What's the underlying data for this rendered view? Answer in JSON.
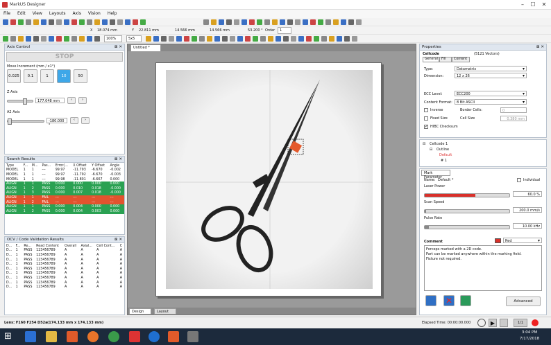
{
  "app": {
    "title": "MarkUS Designer"
  },
  "menu": [
    "File",
    "Edit",
    "View",
    "Layouts",
    "Axis",
    "Vision",
    "Help"
  ],
  "toolbar": {
    "x_label": "X",
    "x_value": "18.074 mm",
    "y_label": "Y",
    "y_value": "22.811 mm",
    "w_value": "14.566 mm",
    "h_value": "14.566 mm",
    "angle_value": "53.200 °",
    "order_label": "Order",
    "order_value": "1",
    "zoom": "100%",
    "zoom2": "5x5"
  },
  "axis": {
    "title": "Axis Control",
    "stop": "STOP",
    "increment_label": "Move Increment (mm / x1°)",
    "increments": [
      "0.025",
      "0.1",
      "1",
      "10",
      "50"
    ],
    "selected_index": 3,
    "z_label": "Z Axis",
    "z_value": "177.048 mm",
    "a2_label": "A2 Axis",
    "a2_value": "-180.000 °"
  },
  "search": {
    "title": "Search Results",
    "headers": [
      "Type",
      "F...",
      "M...",
      "Pas...",
      "Error(...",
      "X Offset",
      "Y Offset",
      "Angle"
    ],
    "rows": [
      {
        "s": "",
        "c": [
          "MODEL",
          "1",
          "1",
          "---",
          "99.97",
          "-11.793",
          "-6.670",
          "-0.002"
        ]
      },
      {
        "s": "",
        "c": [
          "MODEL",
          "1",
          "1",
          "---",
          "99.97",
          "-11.792",
          "-6.670",
          "-0.003"
        ]
      },
      {
        "s": "",
        "c": [
          "MODEL",
          "1",
          "1",
          "---",
          "99.98",
          "-11.801",
          "-6.667",
          "0.000"
        ]
      },
      {
        "s": "green",
        "c": [
          "ALIGN",
          "1",
          "1",
          "PASS",
          "0.000",
          "0.000",
          "0.000",
          "0.000"
        ]
      },
      {
        "s": "green",
        "c": [
          "ALIGN",
          "1",
          "2",
          "PASS",
          "0.000",
          "0.010",
          "0.018",
          "-0.000"
        ]
      },
      {
        "s": "green",
        "c": [
          "ALIGN",
          "1",
          "3",
          "PASS",
          "0.000",
          "0.007",
          "0.018",
          "-0.000"
        ]
      },
      {
        "s": "red",
        "c": [
          "ALIGN",
          "1",
          "1",
          "FAIL",
          "---",
          "---",
          "---",
          "---"
        ]
      },
      {
        "s": "red",
        "c": [
          "ALIGN",
          "1",
          "2",
          "FAIL",
          "---",
          "---",
          "---",
          "---"
        ]
      },
      {
        "s": "green",
        "c": [
          "ALIGN",
          "1",
          "1",
          "PASS",
          "0.000",
          "0.004",
          "0.000",
          "0.000"
        ]
      },
      {
        "s": "green",
        "c": [
          "ALIGN",
          "1",
          "2",
          "PASS",
          "0.000",
          "0.004",
          "0.003",
          "0.000"
        ]
      }
    ]
  },
  "ocv": {
    "title": "OCV / Code Validation Results",
    "headers": [
      "D...",
      "F...",
      "Re...",
      "Read Content",
      "Overall",
      "Axial...",
      "Cell Cont...",
      "C"
    ],
    "rows": [
      [
        "D...",
        "1",
        "PASS",
        "123456789",
        "A",
        "A",
        "A",
        "A"
      ],
      [
        "D...",
        "1",
        "PASS",
        "123456789",
        "A",
        "A",
        "A",
        "A"
      ],
      [
        "D...",
        "1",
        "PASS",
        "123456789",
        "A",
        "A",
        "A",
        "A"
      ],
      [
        "D...",
        "1",
        "PASS",
        "123456789",
        "A",
        "A",
        "A",
        "A"
      ],
      [
        "D...",
        "1",
        "PASS",
        "123456789",
        "A",
        "A",
        "A",
        "A"
      ],
      [
        "D...",
        "1",
        "PASS",
        "123456789",
        "A",
        "A",
        "A",
        "A"
      ],
      [
        "D...",
        "1",
        "PASS",
        "123456789",
        "A",
        "A",
        "A",
        "A"
      ],
      [
        "D...",
        "1",
        "PASS",
        "123456789",
        "A",
        "A",
        "A",
        "A"
      ],
      [
        "D...",
        "1",
        "PASS",
        "123456789",
        "A",
        "A",
        "A",
        "A"
      ]
    ]
  },
  "canvas": {
    "tab": "Untitled *",
    "bottom_tabs": [
      "Design",
      "Layout"
    ]
  },
  "properties": {
    "title": "Properties",
    "object": "Cellcode",
    "vectors": "(5121 Vectors)",
    "tabs": [
      "General",
      "Fill",
      "Content"
    ],
    "type_label": "Type:",
    "type_value": "Datamatrix",
    "dimension_label": "Dimension:",
    "dimension_value": "12 x 26",
    "ecc_label": "ECC Level:",
    "ecc_value": "ECC200",
    "content_format_label": "Content Format:",
    "content_format_value": "8 Bit ASCII",
    "inverse_label": "Inverse",
    "border_cells_label": "Border Cells:",
    "border_cells_value": "0",
    "fixed_size_label": "Fixed Size",
    "cell_size_label": "Cell Size",
    "cell_size_value": "0.380 mm",
    "hibc_label": "HIBC Checksum"
  },
  "tree": {
    "root": "Cellcode 1",
    "child": "Outline",
    "leaf": "Default",
    "leaf2": "# 1"
  },
  "mark": {
    "title": "Mark Parameter",
    "name_label": "Name:",
    "name_value": "Default *",
    "individual_label": "Individual",
    "power_label": "Laser Power",
    "power_value": "60.0 %",
    "power_fraction": 0.6,
    "speed_label": "Scan Speed",
    "speed_value": "200.0 mm/s",
    "speed_fraction": 0.02,
    "rate_label": "Pulse Rate",
    "rate_value": "10.00 kHz",
    "rate_fraction": 0.05,
    "comment_label": "Comment",
    "color_value": "Red",
    "comment_lines": [
      "Forceps marked with a 2D code.",
      "Part can be marked anywhere within the marking field.",
      "Fixture not required."
    ],
    "advanced": "Advanced"
  },
  "status": {
    "lens": "Lens: F160 F254 D52a",
    "field": "(174.133 mm x 174.133 mm)",
    "elapsed": "Elapsed Time: 00:00:00.000",
    "counter": "1/1"
  },
  "taskbar": {
    "time": "3:04 PM",
    "date": "7/17/2018"
  },
  "colors": {
    "accent": "#2aa152",
    "fail": "#e2532e",
    "laser": "#d9302a",
    "selected": "#3ea7e8"
  }
}
